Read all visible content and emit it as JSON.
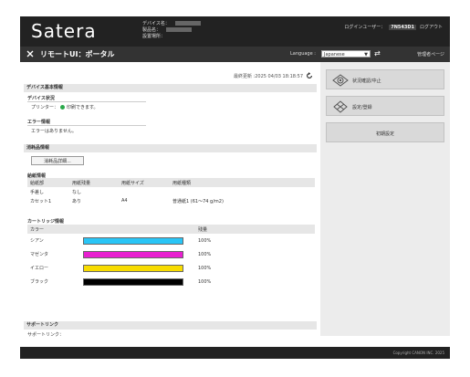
{
  "header": {
    "logo": "Satera",
    "device_name_label": "デバイス名：",
    "product_name_label": "製品名：",
    "location_label": "設置場所：",
    "login_user_label": "ログインユーザー：",
    "login_user_name": "7N543D1",
    "logout": "ログアウト"
  },
  "titlebar": {
    "title": "リモートUI：ポータル",
    "language_label": "Language :",
    "language_value": "Japanese",
    "mgmt_link": "管理者ページ"
  },
  "main": {
    "last_updated": "最終更新 :2025 04/03 18:18:57",
    "section_device": "デバイス基本情報",
    "device_status_title": "デバイス状況",
    "printer_label": "プリンター：",
    "printer_status": "印刷できます。",
    "error_title": "エラー情報",
    "error_text": "エラーはありません。",
    "section_consumables": "消耗品情報",
    "check_consumables_button": "消耗品詳細...",
    "paper_title": "給紙情報",
    "paper_headers": [
      "給紙部",
      "用紙残量",
      "用紙サイズ",
      "用紙種類"
    ],
    "paper_rows": [
      [
        "手差し",
        "なし",
        "",
        ""
      ],
      [
        "カセット1",
        "あり",
        "A4",
        "普通紙1 (61～74 g/m2)"
      ]
    ],
    "cartridge_title": "カートリッジ情報",
    "cartridge_headers": [
      "カラー",
      "",
      "残量"
    ],
    "cartridges": [
      {
        "name": "シアン",
        "color": "#29c5f6",
        "level": "100%"
      },
      {
        "name": "マゼンタ",
        "color": "#e81fd0",
        "level": "100%"
      },
      {
        "name": "イエロー",
        "color": "#f8dc00",
        "level": "100%"
      },
      {
        "name": "ブラック",
        "color": "#000000",
        "level": "100%"
      }
    ],
    "section_support": "サポートリンク",
    "support_text": "サポートリンク："
  },
  "side": {
    "status_button": "状況確認/中止",
    "settings_button": "設定/登録",
    "initial_button": "初期設定"
  },
  "footer": {
    "copyright": "Copyright CANON INC. 2025"
  }
}
